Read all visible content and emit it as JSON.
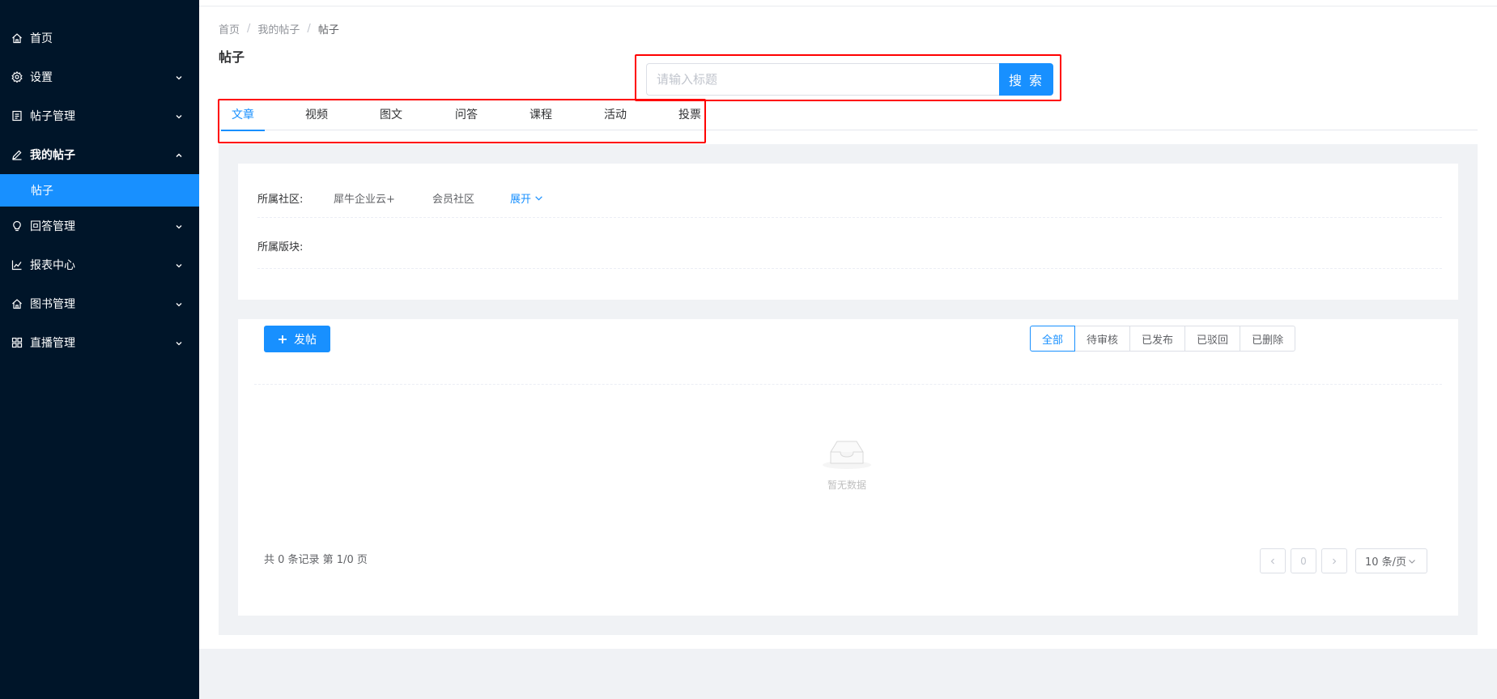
{
  "sidebar": {
    "items": [
      {
        "label": "首页",
        "icon": "home-icon"
      },
      {
        "label": "设置",
        "icon": "gear-icon"
      },
      {
        "label": "帖子管理",
        "icon": "document-icon"
      },
      {
        "label": "我的帖子",
        "icon": "edit-icon"
      },
      {
        "label": "回答管理",
        "icon": "lightbulb-icon"
      },
      {
        "label": "报表中心",
        "icon": "line-chart-icon"
      },
      {
        "label": "图书管理",
        "icon": "home-icon"
      },
      {
        "label": "直播管理",
        "icon": "grid-icon"
      }
    ],
    "active_sub": "帖子"
  },
  "breadcrumb": [
    "首页",
    "我的帖子",
    "帖子"
  ],
  "page_title": "帖子",
  "search": {
    "placeholder": "请输入标题",
    "button": "搜 索"
  },
  "tabs": [
    "文章",
    "视频",
    "图文",
    "问答",
    "课程",
    "活动",
    "投票"
  ],
  "filters": {
    "community_label": "所属社区:",
    "communities": [
      "犀牛企业云+",
      "会员社区"
    ],
    "expand": "展开",
    "section_label": "所属版块:"
  },
  "list": {
    "post_button": "发帖",
    "statuses": [
      "全部",
      "待审核",
      "已发布",
      "已驳回",
      "已删除"
    ],
    "empty_text": "暂无数据"
  },
  "pagination": {
    "info": "共 0 条记录 第 1/0 页",
    "page": "0",
    "page_size": "10 条/页"
  },
  "colors": {
    "sidebar_bg": "#001529",
    "accent": "#1890ff",
    "highlight_box": "#ff0000"
  }
}
